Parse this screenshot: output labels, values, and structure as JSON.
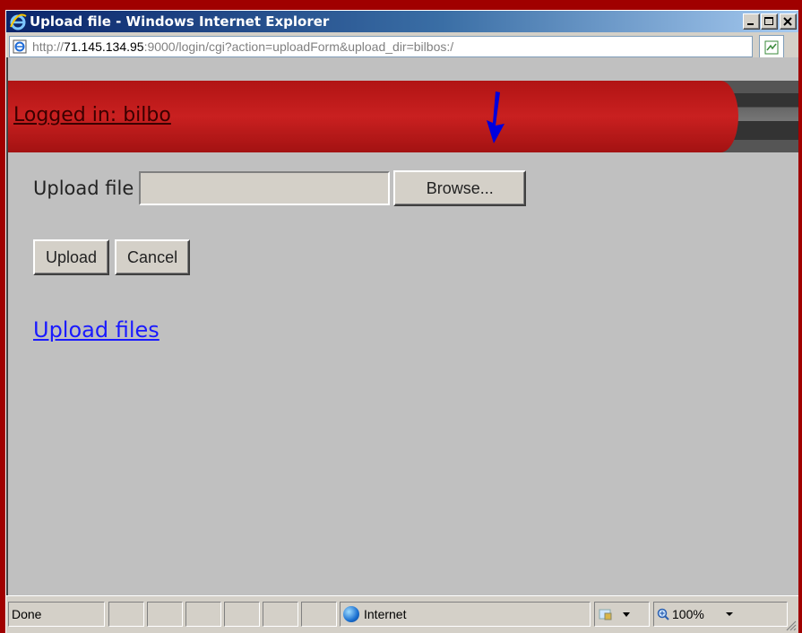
{
  "window": {
    "title": "Upload file - Windows Internet Explorer",
    "minimize_glyph": "_",
    "maximize_glyph": "□",
    "close_glyph": "×"
  },
  "address": {
    "prefix": "http://",
    "host": "71.145.134.95",
    "rest": ":9000/login/cgi?action=uploadForm&upload_dir=bilbos:/"
  },
  "page": {
    "logged_in": "Logged in: bilbo",
    "upload_label": "Upload file",
    "file_value": "",
    "browse_label": "Browse...",
    "upload_button": "Upload",
    "cancel_button": "Cancel",
    "upload_files_link": "Upload files"
  },
  "status": {
    "text": "Done",
    "zone": "Internet",
    "zoom": "100%"
  },
  "colors": {
    "banner_red": "#c41c1c",
    "link_blue": "#1a1aff",
    "arrow_blue": "#0000dd"
  },
  "icons": [
    "ie-logo-icon",
    "page-icon",
    "compat-view-icon",
    "arrow-down-icon",
    "globe-icon",
    "protected-mode-icon",
    "zoom-icon",
    "size-grip-icon"
  ]
}
